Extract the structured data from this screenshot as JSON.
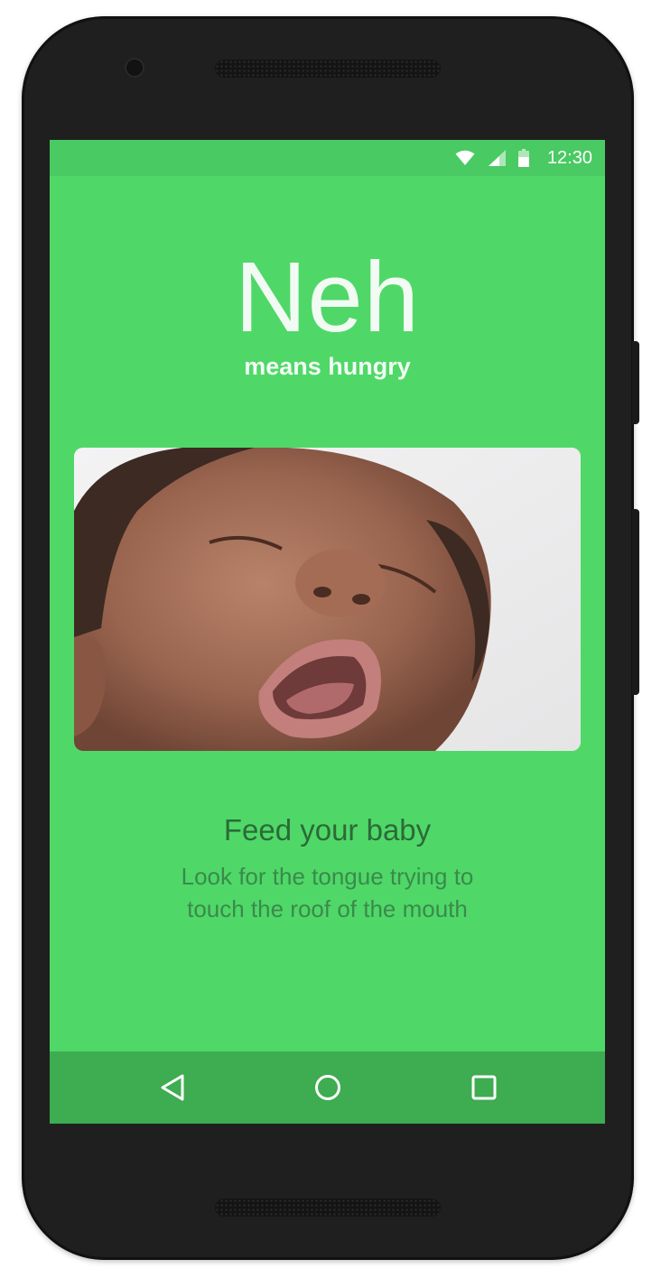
{
  "status_bar": {
    "time": "12:30",
    "icons": [
      "wifi-icon",
      "cell-signal-icon",
      "battery-icon"
    ]
  },
  "main": {
    "headline": "Neh",
    "subheadline": "means hungry",
    "photo": "crying-baby-photo",
    "card_title": "Feed your baby",
    "card_body_line1": "Look for the tongue trying to",
    "card_body_line2": "touch the roof of the mouth"
  },
  "nav_bar": {
    "icons": [
      "back-icon",
      "home-icon",
      "recents-icon"
    ]
  },
  "colors": {
    "screen_bg": "#4fd868",
    "status_bar_bg": "#49ca62",
    "nav_bar_bg": "#3eac51",
    "title_text": "#2c6a38",
    "body_text": "#3a8a4b"
  }
}
